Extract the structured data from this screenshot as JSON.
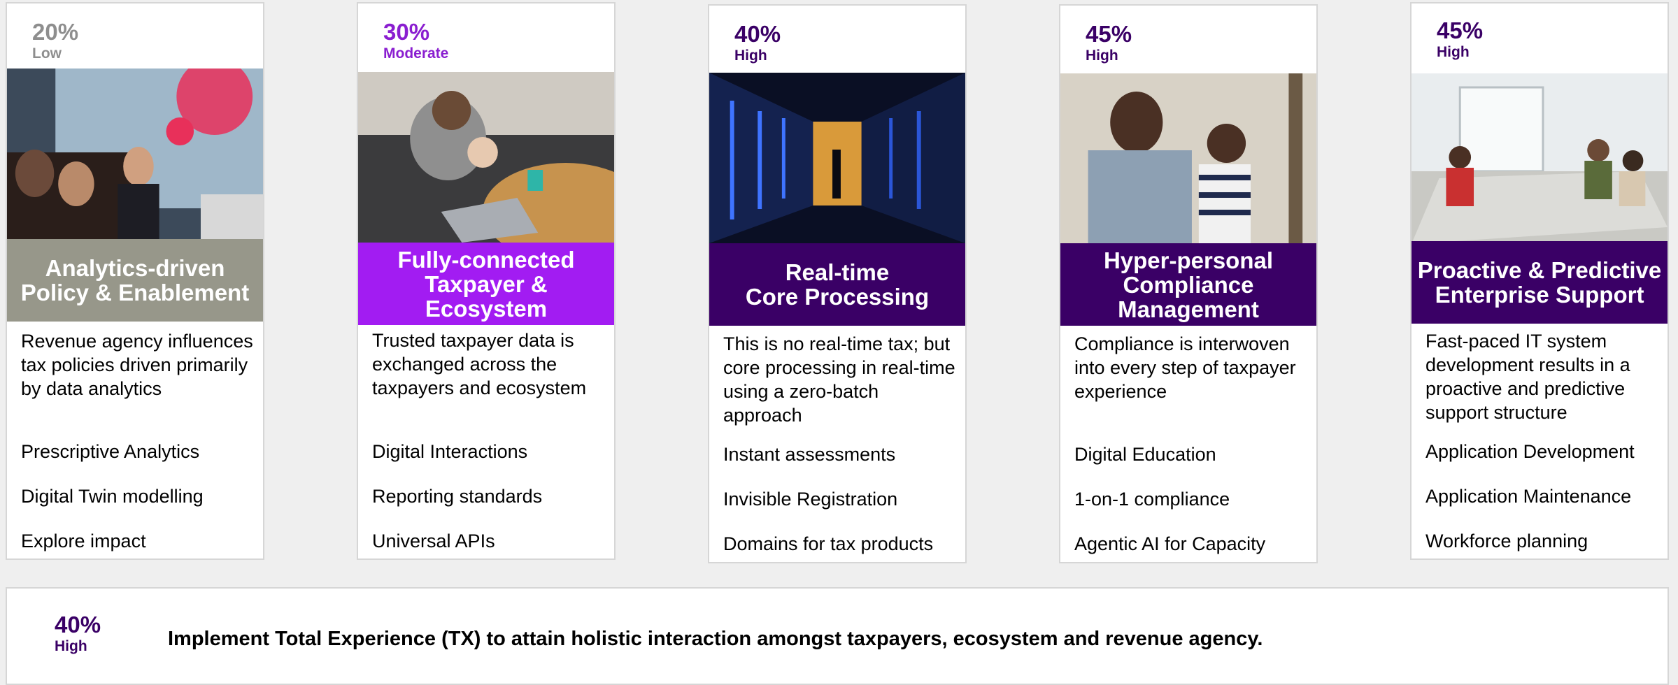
{
  "colors": {
    "gray": "#97978a",
    "gray_text": "#8e8e8e",
    "violet": "#a21cf2",
    "violet_text": "#8a1ed0",
    "deep_purple": "#3a0066",
    "deep_purple_text": "#3a0066"
  },
  "cards": [
    {
      "percent": "20%",
      "level": "Low",
      "title_line1": "Analytics-driven",
      "title_line2": "Policy & Enablement",
      "title_line3": "",
      "description": "Revenue agency influences tax policies driven primarily by data analytics",
      "items": [
        "Prescriptive Analytics",
        "Digital Twin modelling",
        "Explore impact"
      ],
      "image_icon": "presentation-photo"
    },
    {
      "percent": "30%",
      "level": "Moderate",
      "title_line1": "Fully-connected",
      "title_line2": "Taxpayer & Ecosystem",
      "title_line3": "",
      "description": "Trusted taxpayer data is exchanged across the taxpayers and ecosystem",
      "items": [
        "Digital Interactions",
        "Reporting standards",
        "Universal APIs"
      ],
      "image_icon": "laptop-photo"
    },
    {
      "percent": "40%",
      "level": "High",
      "title_line1": "Real-time",
      "title_line2": "Core Processing",
      "title_line3": "",
      "description": "This is no real-time tax; but core processing in real-time using a zero-batch approach",
      "items": [
        "Instant assessments",
        "Invisible Registration",
        "Domains for tax products"
      ],
      "image_icon": "datacenter-photo"
    },
    {
      "percent": "45%",
      "level": "High",
      "title_line1": "Hyper-personal",
      "title_line2": "Compliance",
      "title_line3": "Management",
      "description": "Compliance is interwoven into every step of taxpayer experience",
      "items": [
        "Digital Education",
        "1-on-1 compliance",
        "Agentic AI for Capacity"
      ],
      "image_icon": "father-child-photo"
    },
    {
      "percent": "45%",
      "level": "High",
      "title_line1": "Proactive & Predictive",
      "title_line2": "Enterprise Support",
      "title_line3": "",
      "description": "Fast-paced IT system development results in a proactive and predictive support structure",
      "items": [
        "Application Development",
        "Application Maintenance",
        "Workforce planning"
      ],
      "image_icon": "office-photo"
    }
  ],
  "footer": {
    "percent": "40%",
    "level": "High",
    "text": "Implement Total Experience (TX) to attain holistic interaction amongst taxpayers, ecosystem and revenue agency."
  }
}
